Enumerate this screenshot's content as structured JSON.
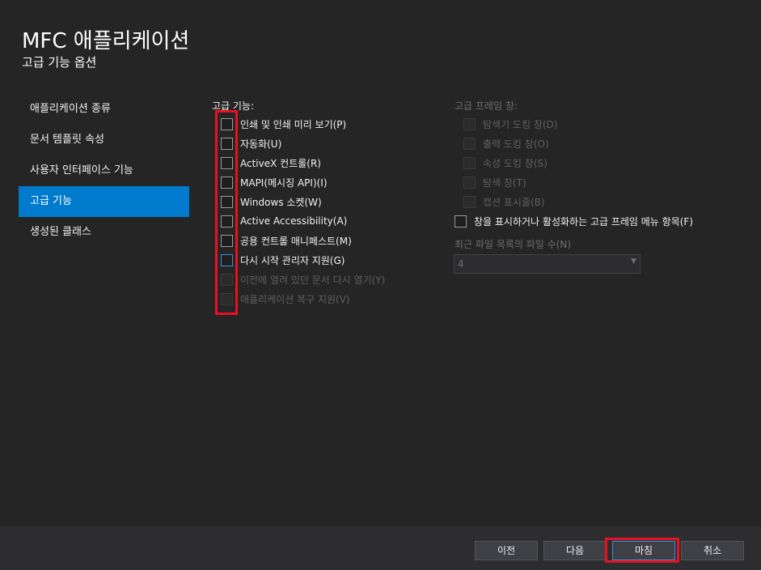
{
  "header": {
    "title": "MFC 애플리케이션",
    "subtitle": "고급 기능 옵션"
  },
  "nav": {
    "items": [
      {
        "label": "애플리케이션 종류"
      },
      {
        "label": "문서 템플릿 속성"
      },
      {
        "label": "사용자 인터페이스 기능"
      },
      {
        "label": "고급 기능",
        "selected": true
      },
      {
        "label": "생성된 클래스"
      }
    ]
  },
  "advanced": {
    "label": "고급 기능:",
    "options": [
      {
        "label": "인쇄 및 인쇄 미리 보기(P)",
        "checked": false,
        "enabled": true
      },
      {
        "label": "자동화(U)",
        "checked": false,
        "enabled": true
      },
      {
        "label": "ActiveX 컨트롤(R)",
        "checked": false,
        "enabled": true
      },
      {
        "label": "MAPI(메시징 API)(I)",
        "checked": false,
        "enabled": true
      },
      {
        "label": "Windows 소켓(W)",
        "checked": false,
        "enabled": true
      },
      {
        "label": "Active Accessibility(A)",
        "checked": false,
        "enabled": true
      },
      {
        "label": "공용 컨트롤 매니페스트(M)",
        "checked": false,
        "enabled": true
      },
      {
        "label": "다시 시작 관리자 지원(G)",
        "checked": false,
        "enabled": true,
        "focused": true
      },
      {
        "label": "이전에 열려 있던 문서 다시 열기(Y)",
        "checked": false,
        "enabled": false
      },
      {
        "label": "애플리케이션 복구 지원(V)",
        "checked": false,
        "enabled": false
      }
    ]
  },
  "frame": {
    "label": "고급 프레임 창:",
    "options": [
      {
        "label": "탐색기 도킹 창(D)",
        "checked": false,
        "enabled": false
      },
      {
        "label": "출력 도킹 창(O)",
        "checked": false,
        "enabled": false
      },
      {
        "label": "속성 도킹 창(S)",
        "checked": false,
        "enabled": false
      },
      {
        "label": "탐색 창(T)",
        "checked": false,
        "enabled": false
      },
      {
        "label": "캡션 표시줄(B)",
        "checked": false,
        "enabled": false
      }
    ],
    "menu_option": {
      "label": "창을 표시하거나 활성화하는 고급 프레임 메뉴 항목(F)",
      "checked": false
    }
  },
  "mru": {
    "label": "최근 파일 목록의 파일 수(N)",
    "value": "4"
  },
  "footer": {
    "prev": "이전",
    "next": "다음",
    "finish": "마침",
    "cancel": "취소"
  },
  "colors": {
    "background": "#252526",
    "accent": "#007acc",
    "highlight": "#e81123",
    "disabled_text": "#6d6d6d"
  }
}
